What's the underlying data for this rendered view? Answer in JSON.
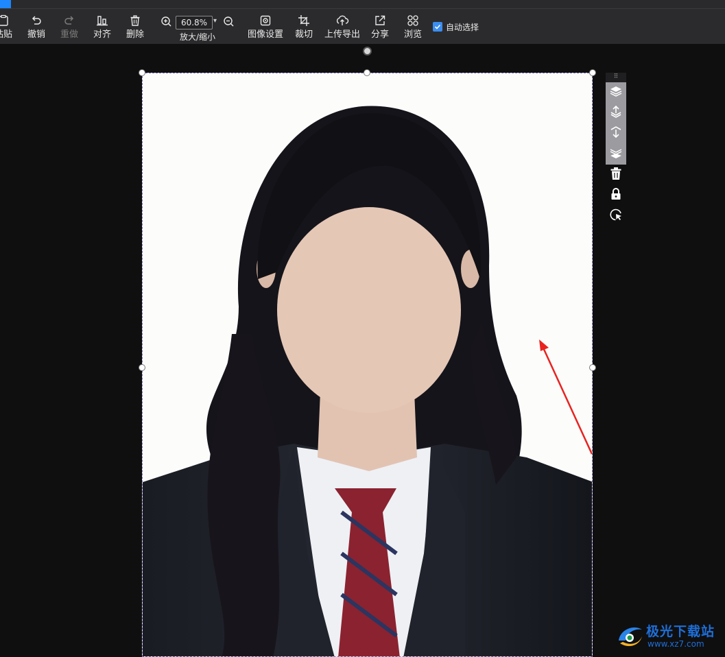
{
  "toolbar": {
    "items": [
      {
        "label": "粘贴",
        "icon": "paste-icon",
        "disabled": false
      },
      {
        "label": "撤销",
        "icon": "undo-icon",
        "disabled": false
      },
      {
        "label": "重做",
        "icon": "redo-icon",
        "disabled": true
      },
      {
        "label": "对齐",
        "icon": "align-icon",
        "disabled": false
      },
      {
        "label": "删除",
        "icon": "trash-icon",
        "disabled": false
      },
      {
        "label": "图像设置",
        "icon": "image-settings-icon",
        "disabled": false
      },
      {
        "label": "裁切",
        "icon": "crop-icon",
        "disabled": false
      },
      {
        "label": "上传导出",
        "icon": "cloud-upload-icon",
        "disabled": false
      },
      {
        "label": "分享",
        "icon": "share-icon",
        "disabled": false
      },
      {
        "label": "浏览",
        "icon": "browse-grid-icon",
        "disabled": false
      }
    ],
    "zoom": {
      "value": "60.8%",
      "label": "放大/缩小"
    },
    "auto_select": {
      "label": "自动选择",
      "checked": true
    }
  },
  "side_panel": {
    "icons": [
      "layer-top-icon",
      "layer-up-icon",
      "layer-down-icon",
      "layer-bottom-icon",
      "trash-icon",
      "lock-icon",
      "select-cursor-icon"
    ]
  },
  "watermark": {
    "title": "极光下载站",
    "url": "www.xz7.com"
  },
  "colors": {
    "accent": "#1e88ff",
    "checkbox": "#3b8ef0",
    "arrow": "#e8231f",
    "tie": "#8b2230",
    "suit": "#1c1e25"
  }
}
